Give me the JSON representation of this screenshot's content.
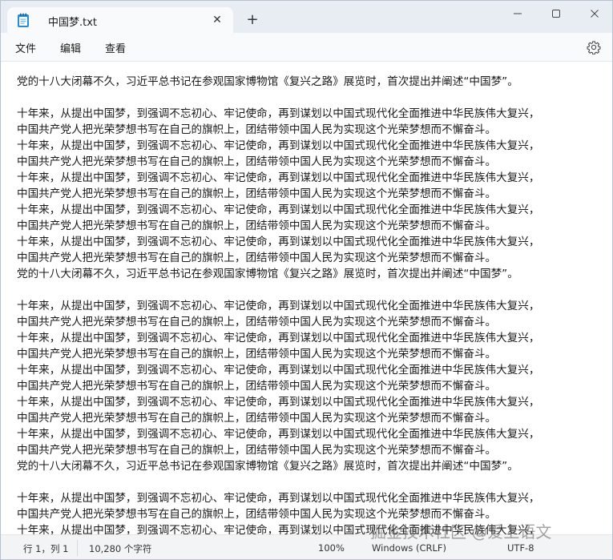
{
  "window": {
    "tab_title": "中国梦.txt",
    "new_tab_label": "+",
    "close_tab_label": "✕"
  },
  "menu": {
    "file": "文件",
    "edit": "编辑",
    "view": "查看"
  },
  "editor": {
    "lines": [
      "党的十八大闭幕不久，习近平总书记在参观国家博物馆《复兴之路》展览时，首次提出并阐述“中国梦”。",
      "",
      "十年来，从提出中国梦，到强调不忘初心、牢记使命，再到谋划以中国式现代化全面推进中华民族伟大复兴，",
      "中国共产党人把光荣梦想书写在自己的旗帜上，团结带领中国人民为实现这个光荣梦想而不懈奋斗。",
      "十年来，从提出中国梦，到强调不忘初心、牢记使命，再到谋划以中国式现代化全面推进中华民族伟大复兴，",
      "中国共产党人把光荣梦想书写在自己的旗帜上，团结带领中国人民为实现这个光荣梦想而不懈奋斗。",
      "十年来，从提出中国梦，到强调不忘初心、牢记使命，再到谋划以中国式现代化全面推进中华民族伟大复兴，",
      "中国共产党人把光荣梦想书写在自己的旗帜上，团结带领中国人民为实现这个光荣梦想而不懈奋斗。",
      "十年来，从提出中国梦，到强调不忘初心、牢记使命，再到谋划以中国式现代化全面推进中华民族伟大复兴，",
      "中国共产党人把光荣梦想书写在自己的旗帜上，团结带领中国人民为实现这个光荣梦想而不懈奋斗。",
      "十年来，从提出中国梦，到强调不忘初心、牢记使命，再到谋划以中国式现代化全面推进中华民族伟大复兴，",
      "中国共产党人把光荣梦想书写在自己的旗帜上，团结带领中国人民为实现这个光荣梦想而不懈奋斗。",
      "党的十八大闭幕不久，习近平总书记在参观国家博物馆《复兴之路》展览时，首次提出并阐述“中国梦”。",
      "",
      "十年来，从提出中国梦，到强调不忘初心、牢记使命，再到谋划以中国式现代化全面推进中华民族伟大复兴，",
      "中国共产党人把光荣梦想书写在自己的旗帜上，团结带领中国人民为实现这个光荣梦想而不懈奋斗。",
      "十年来，从提出中国梦，到强调不忘初心、牢记使命，再到谋划以中国式现代化全面推进中华民族伟大复兴，",
      "中国共产党人把光荣梦想书写在自己的旗帜上，团结带领中国人民为实现这个光荣梦想而不懈奋斗。",
      "十年来，从提出中国梦，到强调不忘初心、牢记使命，再到谋划以中国式现代化全面推进中华民族伟大复兴，",
      "中国共产党人把光荣梦想书写在自己的旗帜上，团结带领中国人民为实现这个光荣梦想而不懈奋斗。",
      "十年来，从提出中国梦，到强调不忘初心、牢记使命，再到谋划以中国式现代化全面推进中华民族伟大复兴，",
      "中国共产党人把光荣梦想书写在自己的旗帜上，团结带领中国人民为实现这个光荣梦想而不懈奋斗。",
      "十年来，从提出中国梦，到强调不忘初心、牢记使命，再到谋划以中国式现代化全面推进中华民族伟大复兴，",
      "中国共产党人把光荣梦想书写在自己的旗帜上，团结带领中国人民为实现这个光荣梦想而不懈奋斗。",
      "党的十八大闭幕不久，习近平总书记在参观国家博物馆《复兴之路》展览时，首次提出并阐述“中国梦”。",
      "",
      "十年来，从提出中国梦，到强调不忘初心、牢记使命，再到谋划以中国式现代化全面推进中华民族伟大复兴，",
      "中国共产党人把光荣梦想书写在自己的旗帜上，团结带领中国人民为实现这个光荣梦想而不懈奋斗。",
      "十年来，从提出中国梦，到强调不忘初心、牢记使命，再到谋划以中国式现代化全面推进中华民族伟大复兴，"
    ]
  },
  "status": {
    "position": "行 1，列 1",
    "char_count": "10,280 个字符",
    "zoom": "100%",
    "line_ending": "Windows (CRLF)",
    "encoding": "UTF-8"
  },
  "watermark": "掘金技术社区 @爱上语文",
  "icons": {
    "tab": "notepad-icon",
    "settings": "gear-icon",
    "minimize": "minimize-icon",
    "maximize": "maximize-icon",
    "close": "close-icon"
  },
  "colors": {
    "titlebar": "#e8edf4",
    "tab": "#f9fafb",
    "icon_blue": "#2a8ad4"
  }
}
